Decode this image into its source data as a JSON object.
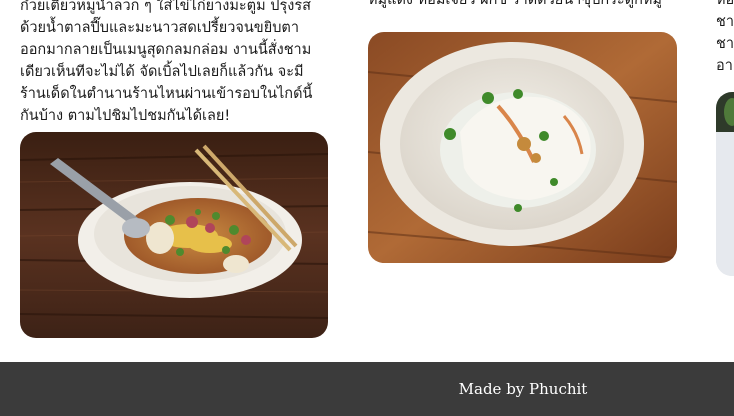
{
  "cards": [
    {
      "text_lines": [
        "ก๋วยเตี๋ยวหมูน้ำลวก ๆ ใส่ไข่ไก่ยางมะตูม ปรุงรส",
        "ด้วยน้ำตาลปี๊บและมะนาวสดเปรี้ยวจนขยิบตา",
        "ออกมากลายเป็นเมนูสุดกลมกล่อม งานนี้สั่งชาม",
        "เดียวเห็นทีจะไม่ได้ จัดเบิ้ลไปเลยก็แล้วกัน จะมี",
        "ร้านเด็ดในตำนานร้านไหนผ่านเข้ารอบในไกด์นี้",
        "กันบ้าง ตามไปชิมไปชมกันได้เลย!"
      ],
      "image_alt": "ก๋วยเตี๋ยวต้มยำ"
    },
    {
      "text_lines": [
        "หมูแดง หอมเจียว ผักชี ราดด้วยน้ำซุปกระดูกหมู"
      ],
      "image_alt": "เกี๊ยวน้ำ"
    },
    {
      "text_lines": [
        "หอ",
        "ชา",
        "ชา",
        "อา"
      ],
      "image_alt": ""
    }
  ],
  "footer": {
    "credit": "Made by Phuchit"
  },
  "colors": {
    "footer_bg": "#3b3b3b",
    "footer_text": "#ffffff",
    "page_bg": "#ffffff"
  }
}
